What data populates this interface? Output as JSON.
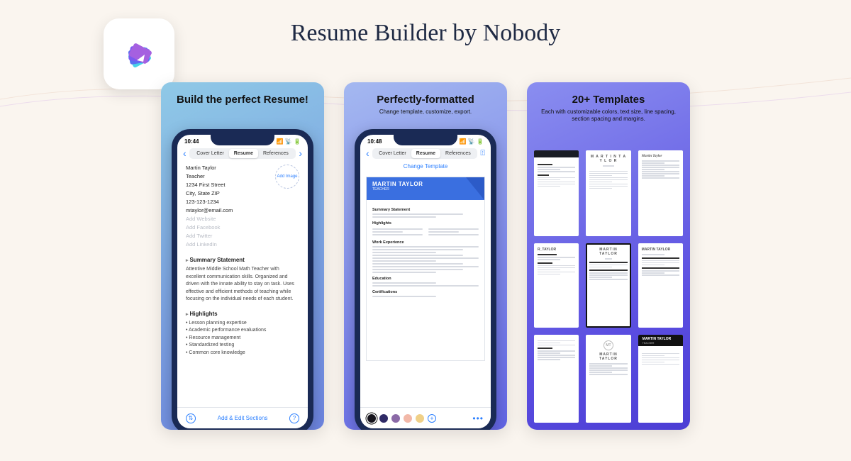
{
  "page": {
    "title": "Resume Builder by Nobody"
  },
  "shot1": {
    "headline_pre": "Build the ",
    "headline_bold": "perfect",
    "headline_post": " Resume!",
    "status_time": "10:44",
    "tabs": {
      "left": "Cover Letter",
      "mid": "Resume",
      "right": "References"
    },
    "contact": {
      "name": "Martin Taylor",
      "role": "Teacher",
      "street": "1234 First Street",
      "city": "City, State ZIP",
      "phone": "123-123-1234",
      "email": "mtaylor@email.com",
      "add_website": "Add Website",
      "add_facebook": "Add Facebook",
      "add_twitter": "Add Twitter",
      "add_linkedin": "Add LinkedIn",
      "add_image": "Add Image"
    },
    "summary": {
      "title": "Summary Statement",
      "body": "Attentive Middle School Math Teacher with excellent communication skills. Organized and driven with the innate ability to stay on task. Uses effective and efficient methods of teaching while focusing on the individual needs of each student."
    },
    "highlights": {
      "title": "Highlights",
      "items": [
        "Lesson planning expertise",
        "Academic performance evaluations",
        "Resource management",
        "Standardized testing",
        "Common core knowledge"
      ]
    },
    "bottom": {
      "arrows": "⇅",
      "label": "Add & Edit Sections",
      "help": "?"
    }
  },
  "shot2": {
    "headline_bold": "Perfectly",
    "headline_post": "-formatted",
    "sub": "Change template, customize, export.",
    "status_time": "10:48",
    "tabs": {
      "left": "Cover Letter",
      "mid": "Resume",
      "right": "References"
    },
    "change_template": "Change Template",
    "preview": {
      "name": "MARTIN TAYLOR",
      "role": "TEACHER",
      "s1": "Summary Statement",
      "s2": "Highlights",
      "s3": "Work Experience",
      "s4": "Education",
      "s5": "Certifications"
    },
    "swatches": [
      "#15131c",
      "#2f2a66",
      "#8b6aa7",
      "#f2b8a8",
      "#f0d087"
    ]
  },
  "shot3": {
    "headline_bold": "20+",
    "headline_post": " Templates",
    "sub": "Each with customizable colors, text size, line spacing, section spacing and margins.",
    "name_upper": "MARTIN TAYLOR",
    "name_spaced": "M A R T I N   T A Y L O R",
    "name_title": "Martin Taylor",
    "role": "TEACHER",
    "name_abbrev": "R_TAYLOR"
  }
}
